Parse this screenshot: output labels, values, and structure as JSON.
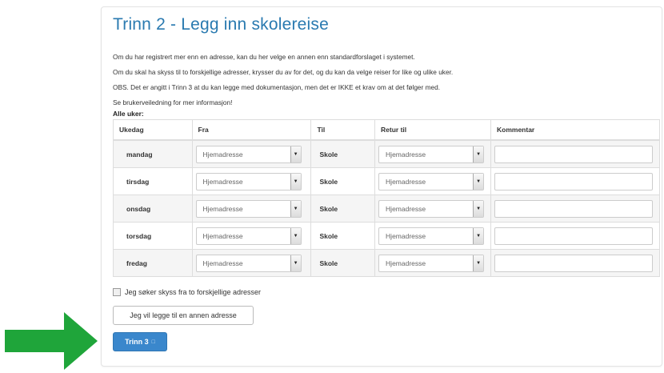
{
  "page": {
    "title": "Trinn 2 - Legg inn skolereise",
    "info_lines": [
      "Om du har registrert mer enn en adresse, kan du her velge en annen enn standardforslaget i systemet.",
      "Om du skal ha skyss til to forskjellige adresser, krysser du av for det, og du kan da velge reiser for like og ulike uker.",
      "OBS. Det er angitt i Trinn 3 at du kan legge med dokumentasjon, men det er IKKE et krav om at det følger med.",
      "Se brukerveiledning for mer informasjon!"
    ],
    "week_label": "Alle uker:"
  },
  "table": {
    "headers": [
      "Ukedag",
      "Fra",
      "Til",
      "Retur til",
      "Kommentar"
    ],
    "rows": [
      {
        "day": "mandag",
        "fra": "Hjemadresse",
        "til": "Skole",
        "retur": "Hjemadresse",
        "kommentar": ""
      },
      {
        "day": "tirsdag",
        "fra": "Hjemadresse",
        "til": "Skole",
        "retur": "Hjemadresse",
        "kommentar": ""
      },
      {
        "day": "onsdag",
        "fra": "Hjemadresse",
        "til": "Skole",
        "retur": "Hjemadresse",
        "kommentar": ""
      },
      {
        "day": "torsdag",
        "fra": "Hjemadresse",
        "til": "Skole",
        "retur": "Hjemadresse",
        "kommentar": ""
      },
      {
        "day": "fredag",
        "fra": "Hjemadresse",
        "til": "Skole",
        "retur": "Hjemadresse",
        "kommentar": ""
      }
    ]
  },
  "two_addresses_checkbox": {
    "label": "Jeg søker skyss fra to forskjellige adresser",
    "checked": false
  },
  "buttons": {
    "add_address": "Jeg vil legge til en annen adresse",
    "next": "Trinn 3"
  },
  "colors": {
    "title": "#2a7ab0",
    "primary_button": "#3a87cc",
    "arrow": "#1fa53a"
  },
  "icons": {
    "select_arrow": "dropdown-arrow-icon",
    "next_icon": "next-step-icon",
    "pointer_arrow": "green-arrow-icon"
  }
}
